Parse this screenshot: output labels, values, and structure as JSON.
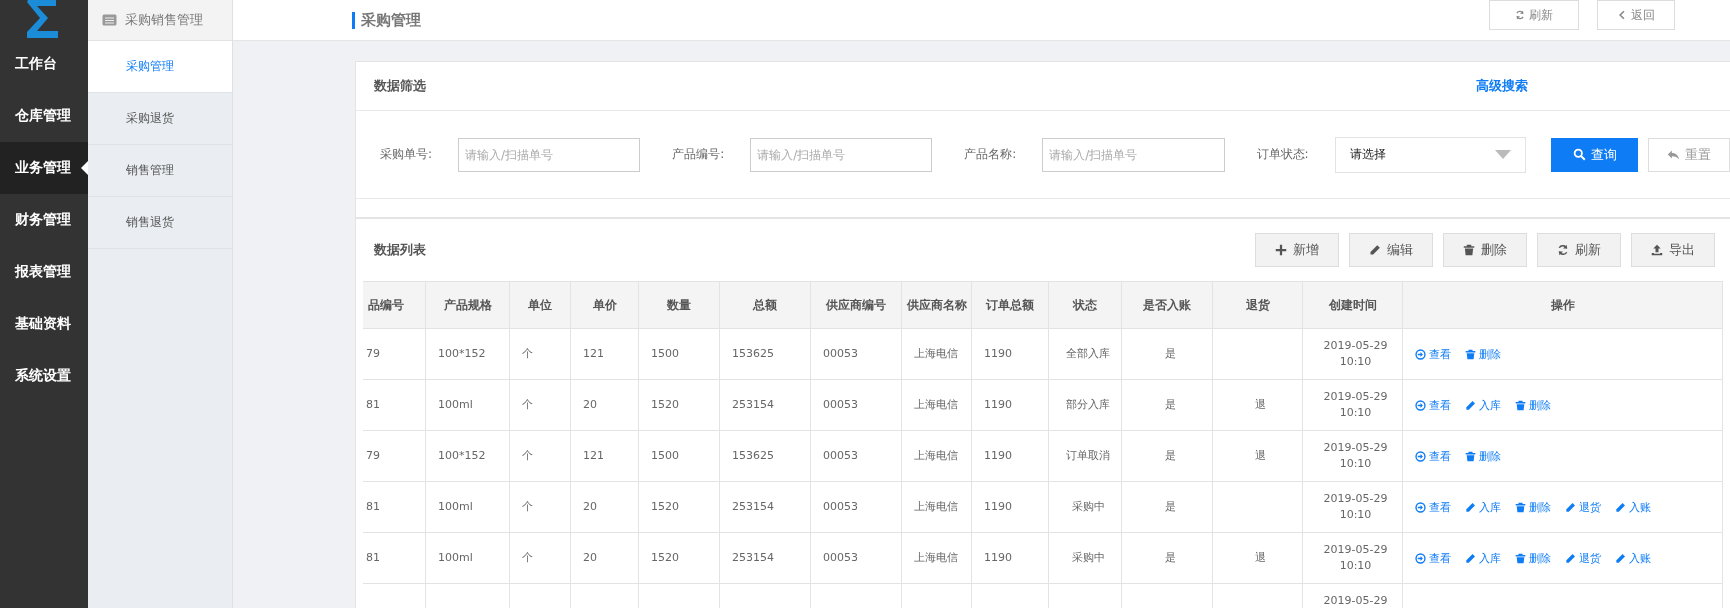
{
  "nav": {
    "items": [
      {
        "label": "工作台",
        "selected": false
      },
      {
        "label": "仓库管理",
        "selected": false
      },
      {
        "label": "业务管理",
        "selected": true
      },
      {
        "label": "财务管理",
        "selected": false
      },
      {
        "label": "报表管理",
        "selected": false
      },
      {
        "label": "基础资料",
        "selected": false
      },
      {
        "label": "系统设置",
        "selected": false
      }
    ]
  },
  "subnav": {
    "title": "采购销售管理",
    "items": [
      {
        "label": "采购管理",
        "selected": true
      },
      {
        "label": "采购退货",
        "selected": false
      },
      {
        "label": "销售管理",
        "selected": false
      },
      {
        "label": "销售退货",
        "selected": false
      }
    ]
  },
  "header": {
    "title": "采购管理",
    "buttons": [
      {
        "kind": "refresh",
        "label": "刷新"
      },
      {
        "kind": "back",
        "label": "返回"
      }
    ]
  },
  "filter": {
    "title": "数据筛选",
    "advanced": "高级搜索",
    "fields": [
      {
        "kind": "input",
        "label": "采购单号:",
        "placeholder": "请输入/扫描单号"
      },
      {
        "kind": "input",
        "label": "产品编号:",
        "placeholder": "请输入/扫描单号"
      },
      {
        "kind": "input",
        "label": "产品名称:",
        "placeholder": "请输入/扫描单号"
      },
      {
        "kind": "select",
        "label": "订单状态:",
        "value": "请选择"
      }
    ],
    "buttons": [
      {
        "kind": "search",
        "label": "查询"
      },
      {
        "kind": "reset",
        "label": "重置"
      }
    ]
  },
  "list": {
    "title": "数据列表",
    "buttons": [
      {
        "kind": "add",
        "label": "新增"
      },
      {
        "kind": "edit",
        "label": "编辑"
      },
      {
        "kind": "delete",
        "label": "删除"
      },
      {
        "kind": "refresh",
        "label": "刷新"
      },
      {
        "kind": "export",
        "label": "导出"
      }
    ],
    "columns": [
      "品编号",
      "产品规格",
      "单位",
      "单价",
      "数量",
      "总额",
      "供应商编号",
      "供应商名称",
      "订单总额",
      "状态",
      "是否入账",
      "退货",
      "创建时间",
      "操作"
    ],
    "rows": [
      {
        "cells": [
          "79",
          "100*152",
          "个",
          "121",
          "1500",
          "153625",
          "00053",
          "上海电信",
          "1190",
          "全部入库",
          "是",
          "",
          "2019-05-29 10:10"
        ],
        "ops": [
          {
            "kind": "view",
            "label": "查看"
          },
          {
            "kind": "delete",
            "label": "删除"
          }
        ]
      },
      {
        "cells": [
          "81",
          "100ml",
          "个",
          "20",
          "1520",
          "253154",
          "00053",
          "上海电信",
          "1190",
          "部分入库",
          "是",
          "退",
          "2019-05-29 10:10"
        ],
        "ops": [
          {
            "kind": "view",
            "label": "查看"
          },
          {
            "kind": "stock",
            "label": "入库"
          },
          {
            "kind": "delete",
            "label": "删除"
          }
        ]
      },
      {
        "cells": [
          "79",
          "100*152",
          "个",
          "121",
          "1500",
          "153625",
          "00053",
          "上海电信",
          "1190",
          "订单取消",
          "是",
          "退",
          "2019-05-29 10:10"
        ],
        "ops": [
          {
            "kind": "view",
            "label": "查看"
          },
          {
            "kind": "delete",
            "label": "删除"
          }
        ]
      },
      {
        "cells": [
          "81",
          "100ml",
          "个",
          "20",
          "1520",
          "253154",
          "00053",
          "上海电信",
          "1190",
          "采购中",
          "是",
          "",
          "2019-05-29 10:10"
        ],
        "ops": [
          {
            "kind": "view",
            "label": "查看"
          },
          {
            "kind": "stock",
            "label": "入库"
          },
          {
            "kind": "delete",
            "label": "删除"
          },
          {
            "kind": "return",
            "label": "退货"
          },
          {
            "kind": "post",
            "label": "入账"
          }
        ]
      },
      {
        "cells": [
          "81",
          "100ml",
          "个",
          "20",
          "1520",
          "253154",
          "00053",
          "上海电信",
          "1190",
          "采购中",
          "是",
          "退",
          "2019-05-29 10:10"
        ],
        "ops": [
          {
            "kind": "view",
            "label": "查看"
          },
          {
            "kind": "stock",
            "label": "入库"
          },
          {
            "kind": "delete",
            "label": "删除"
          },
          {
            "kind": "return",
            "label": "退货"
          },
          {
            "kind": "post",
            "label": "入账"
          }
        ]
      },
      {
        "cells": [
          "",
          "",
          "",
          "",
          "",
          "",
          "",
          "",
          "",
          "",
          "",
          "",
          "2019-05-29"
        ],
        "ops": []
      }
    ]
  }
}
